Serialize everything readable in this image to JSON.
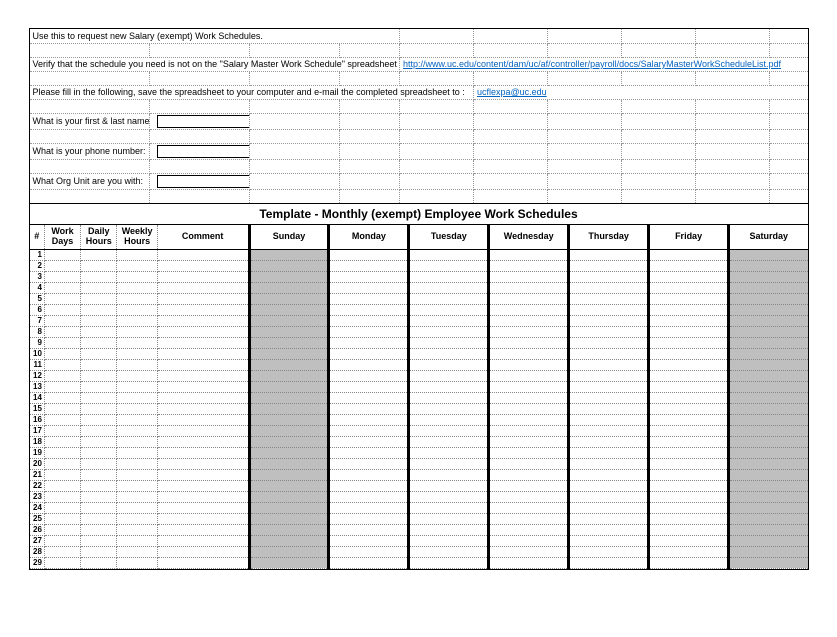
{
  "top": {
    "intro": "Use this to request new Salary (exempt) Work Schedules.",
    "verify_text": "Verify that the schedule you need is not on the \"Salary Master Work Schedule\" spreadsheet at:",
    "verify_link": "http://www.uc.edu/content/dam/uc/af/controller/payroll/docs/SalaryMasterWorkScheduleList.pdf",
    "fill_text": "Please fill in the following, save the spreadsheet to your computer and e-mail the completed spreadsheet to :",
    "fill_email": "ucflexpa@uc.edu",
    "q_name": "What is your first & last name:",
    "q_phone": "What is your phone number:",
    "q_org": "What Org Unit are you with:"
  },
  "title": "Template - Monthly (exempt) Employee Work Schedules",
  "headers": {
    "num": "#",
    "workdays": "Work Days",
    "dailyhours": "Daily Hours",
    "weeklyhours": "Weekly Hours",
    "comment": "Comment",
    "sun": "Sunday",
    "mon": "Monday",
    "tue": "Tuesday",
    "wed": "Wednesday",
    "thu": "Thursday",
    "fri": "Friday",
    "sat": "Saturday"
  },
  "rows": [
    1,
    2,
    3,
    4,
    5,
    6,
    7,
    8,
    9,
    10,
    11,
    12,
    13,
    14,
    15,
    16,
    17,
    18,
    19,
    20,
    21,
    22,
    23,
    24,
    25,
    26,
    27,
    28,
    29
  ]
}
